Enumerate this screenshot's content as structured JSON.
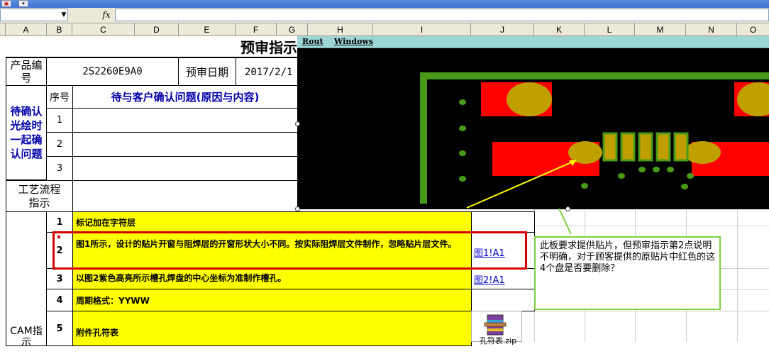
{
  "toolbar": {
    "namebox_value": "",
    "fx_label": "fx",
    "formula_value": ""
  },
  "columns": [
    "A",
    "B",
    "C",
    "D",
    "E",
    "F",
    "G",
    "H",
    "I",
    "J",
    "K",
    "L",
    "M",
    "N",
    "O"
  ],
  "sheet": {
    "title": "预审指示",
    "product_label": "产品编号",
    "product_value": "2S2260E9A0",
    "review_date_label": "预审日期",
    "review_date_value": "2017/2/1",
    "confirm_section_label": "待确认光绘时一起确认问题",
    "seq_header": "序号",
    "issue_header": "待与客户确认问题(原因与内容)",
    "confirm_rows": [
      "1",
      "2",
      "3"
    ],
    "process_label": "工艺流程指示",
    "cam_label": "CAM指示",
    "cam_rows": [
      {
        "num": "1",
        "text": "标记加在字符层",
        "link": ""
      },
      {
        "num": "2",
        "text": "图1所示，设计的贴片开窗与阻焊层的开窗形状大小不同。按实际阻焊层文件制作，忽略贴片层文件。",
        "link": "图1!A1"
      },
      {
        "num": "3",
        "text": "以图2紫色高亮所示槽孔焊盘的中心坐标为准制作槽孔。",
        "link": "图2!A1"
      },
      {
        "num": "4",
        "text": "周期格式：YYWW",
        "link": ""
      },
      {
        "num": "5",
        "text": "附件孔符表",
        "link": ""
      }
    ],
    "attachment_name": "孔符表.zip"
  },
  "pcb_window": {
    "menu": [
      "Rout",
      "Windows"
    ],
    "colors": {
      "background": "#000000",
      "pad_red": "#ff0000",
      "pad_olive": "#c0a000",
      "trace_green": "#4a9a1a"
    }
  },
  "callout_text": "此板要求提供贴片，但预审指示第2点说明不明确，对于顾客提供的原贴片中红色的这4个盘是否要删除？"
}
